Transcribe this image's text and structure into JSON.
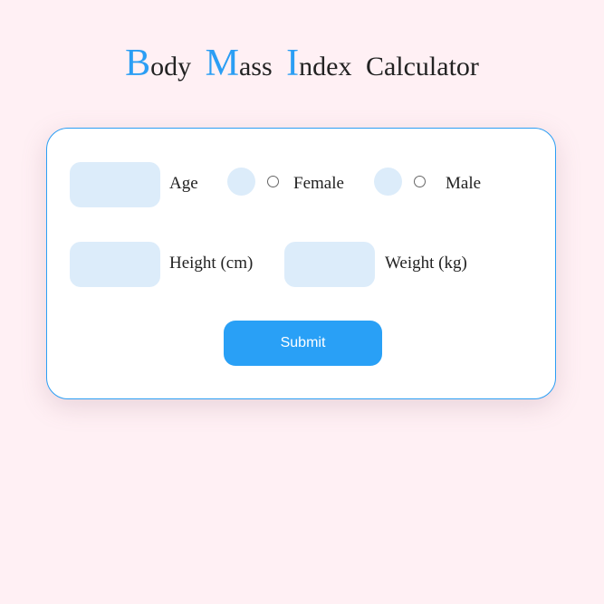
{
  "title": {
    "words": [
      {
        "cap": "B",
        "rest": "ody"
      },
      {
        "cap": "M",
        "rest": "ass"
      },
      {
        "cap": "I",
        "rest": "ndex"
      },
      {
        "cap": "",
        "rest": "Calculator"
      }
    ]
  },
  "form": {
    "age_label": "Age",
    "age_value": "",
    "female_label": "Female",
    "male_label": "Male",
    "height_label": "Height (cm)",
    "height_value": "",
    "weight_label": "Weight (kg)",
    "weight_value": "",
    "submit_label": "Submit"
  },
  "colors": {
    "accent": "#2b9ef4",
    "button": "#29a0f6",
    "input_bg": "#dcecfa",
    "page_bg": "#fff0f4"
  }
}
